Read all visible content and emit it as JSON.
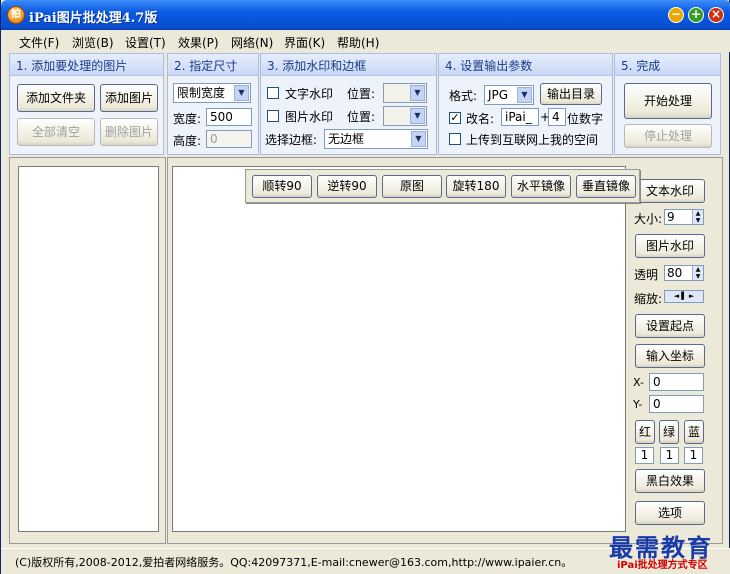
{
  "title": "iPai图片批处理4.7版",
  "titlebar": {
    "minimize": "−",
    "maximize": "+",
    "close": "×"
  },
  "app_icon": "拍",
  "menu": [
    "文件(F)",
    "浏览(B)",
    "设置(T)",
    "效果(P)",
    "网络(N)",
    "界面(K)",
    "帮助(H)"
  ],
  "step1": {
    "header": "1. 添加要处理的图片",
    "add_folder": "添加文件夹",
    "add_image": "添加图片",
    "clear_all": "全部清空",
    "delete_image": "删除图片"
  },
  "step2": {
    "header": "2. 指定尺寸",
    "size_mode": "限制宽度",
    "width_label": "宽度:",
    "width_value": "500",
    "height_label": "高度:",
    "height_value": "0"
  },
  "step3": {
    "header": "3. 添加水印和边框",
    "text_wm": "文字水印",
    "pos1_label": "位置:",
    "image_wm": "图片水印",
    "pos2_label": "位置:",
    "border_label": "选择边框:",
    "border_value": "无边框"
  },
  "step4": {
    "header": "4. 设置输出参数",
    "format_label": "格式:",
    "format_value": "JPG",
    "output_dir": "输出目录",
    "rename_label": "改名:",
    "rename_prefix": "iPai_",
    "plus": "+",
    "digits": "4",
    "digits_suffix": "位数字",
    "upload_label": "上传到互联网上我的空间",
    "rename_checked": "✓"
  },
  "step5": {
    "header": "5. 完成",
    "start": "开始处理",
    "stop": "停止处理"
  },
  "rotate_toolbar": [
    "顺转90",
    "逆转90",
    "原图",
    "旋转180",
    "水平镜像",
    "垂直镜像"
  ],
  "side": {
    "text_wm": "文本水印",
    "size_label": "大小:",
    "size_value": "9",
    "image_wm": "图片水印",
    "opacity_label": "透明",
    "opacity_value": "80",
    "zoom_label": "缩放:",
    "set_origin": "设置起点",
    "input_coords": "输入坐标",
    "x_label": "X-",
    "x_value": "0",
    "y_label": "Y-",
    "y_value": "0",
    "red": "红",
    "green": "绿",
    "blue": "蓝",
    "red_v": "1",
    "green_v": "1",
    "blue_v": "1",
    "bw": "黑白效果",
    "options": "选项"
  },
  "status": "(C)版权所有,2008-2012,爱拍者网络服务。QQ:42097371,E-mail:cnewer@163.com,http://www.ipaier.cn。",
  "watermark": {
    "main": "最需教育",
    "sub": "iPai批处理方式专区"
  }
}
